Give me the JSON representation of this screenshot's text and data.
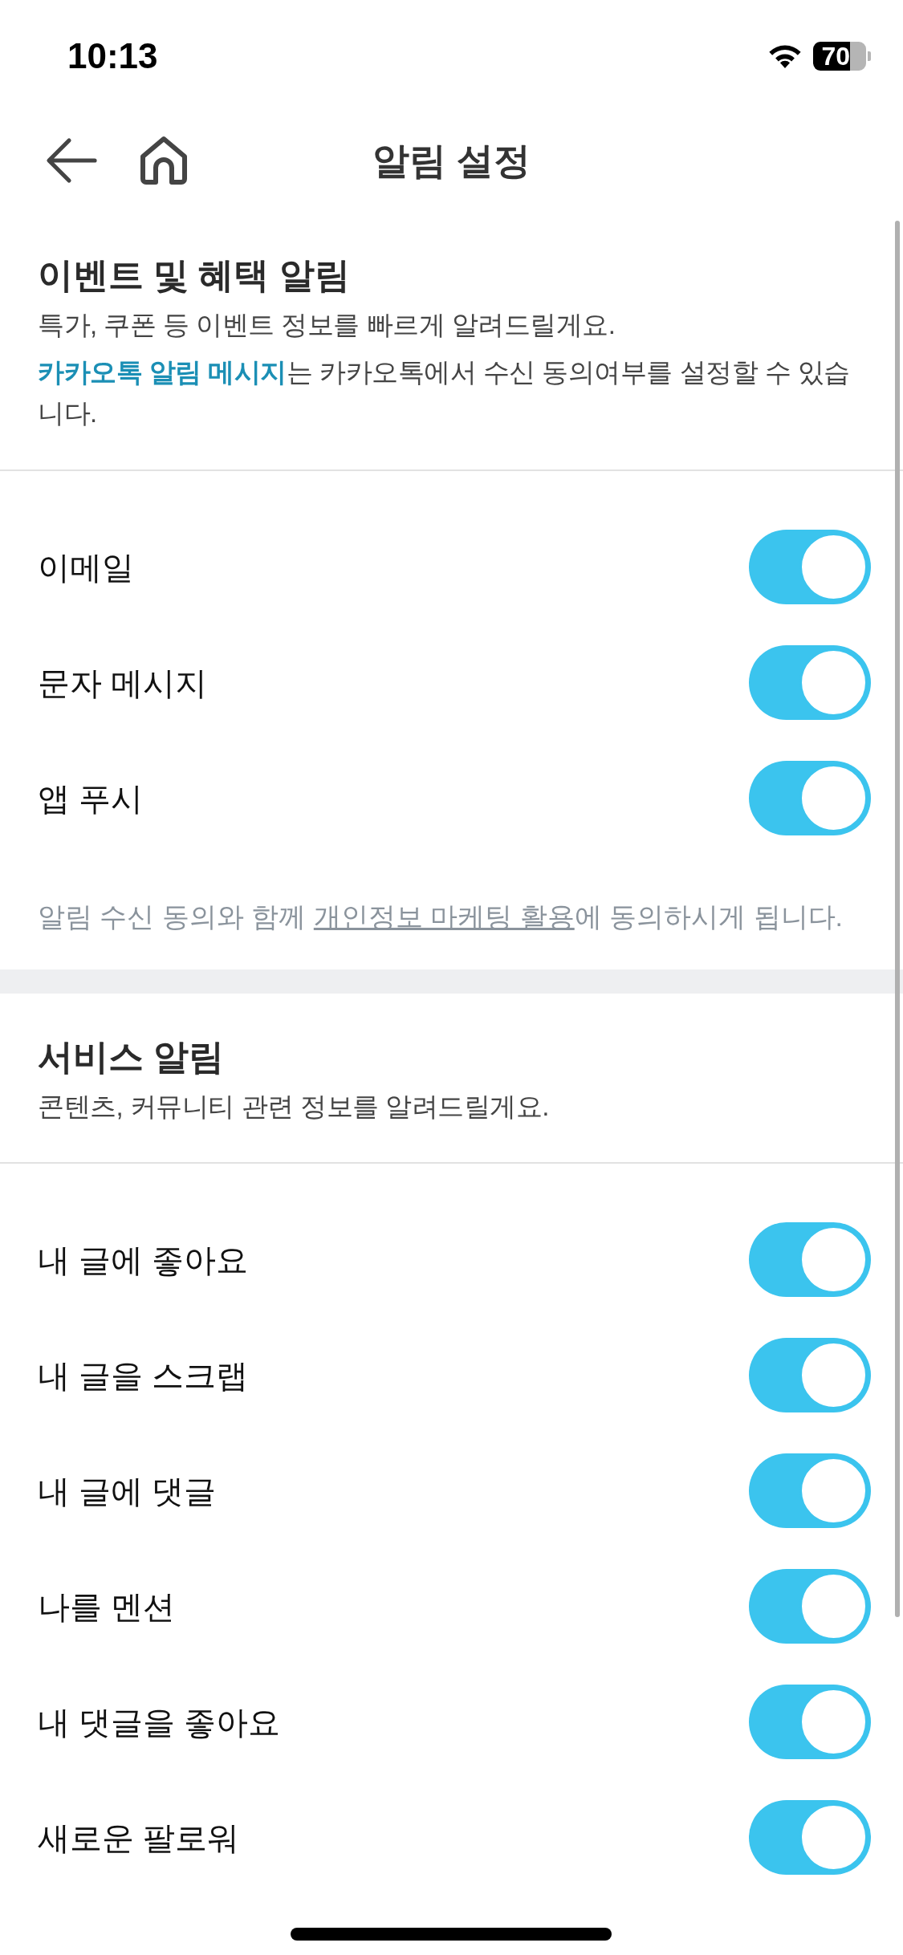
{
  "status_bar": {
    "time": "10:13",
    "battery": "70"
  },
  "nav": {
    "title": "알림 설정"
  },
  "sections": [
    {
      "title": "이벤트 및 혜택 알림",
      "lines": [
        {
          "text": "특가, 쿠폰 등 이벤트 정보를 빠르게 알려드릴게요."
        },
        {
          "link": "카카오톡 알림 메시지",
          "text": "는 카카오톡에서 수신 동의여부를 설정할 수 있습니다."
        }
      ],
      "items": [
        {
          "label": "이메일",
          "on": true
        },
        {
          "label": "문자 메시지",
          "on": true
        },
        {
          "label": "앱 푸시",
          "on": true
        }
      ],
      "footnote": {
        "before": "알림 수신 동의와 함께 ",
        "link": "개인정보 마케팅 활용",
        "after": "에 동의하시게 됩니다."
      }
    },
    {
      "title": "서비스 알림",
      "lines": [
        {
          "text": "콘텐츠, 커뮤니티 관련 정보를 알려드릴게요."
        }
      ],
      "items": [
        {
          "label": "내 글에 좋아요",
          "on": true
        },
        {
          "label": "내 글을 스크랩",
          "on": true
        },
        {
          "label": "내 글에 댓글",
          "on": true
        },
        {
          "label": "나를 멘션",
          "on": true
        },
        {
          "label": "내 댓글을 좋아요",
          "on": true
        },
        {
          "label": "새로운 팔로워",
          "on": true
        }
      ]
    }
  ]
}
